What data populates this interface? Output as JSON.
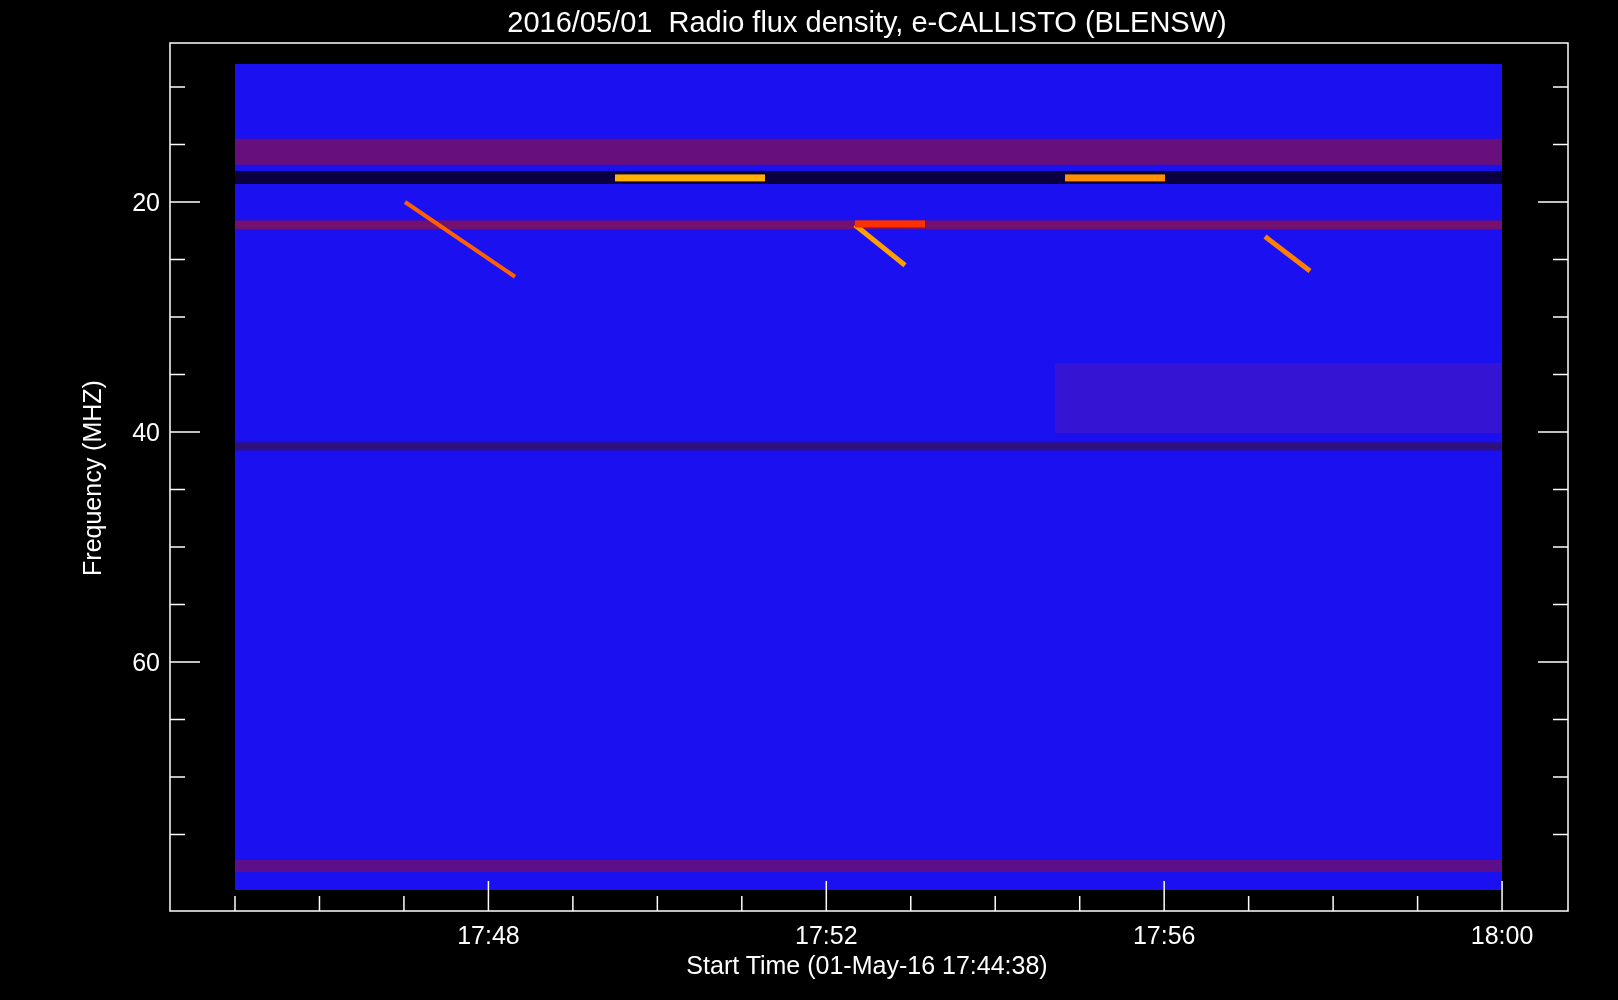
{
  "plot": {
    "title": "2016/05/01  Radio flux density, e-CALLISTO (BLENSW)",
    "xlabel": "Start Time (01-May-16 17:44:38)",
    "ylabel": "Frequency (MHZ)",
    "xticks": [
      "17:48",
      "17:52",
      "17:56",
      "18:00"
    ],
    "yticks": [
      "20",
      "40",
      "60"
    ]
  }
}
